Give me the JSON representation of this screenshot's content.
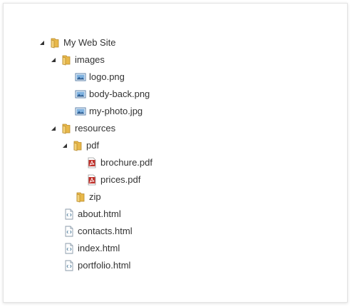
{
  "tree": {
    "nodes": [
      {
        "label": "My Web Site",
        "icon": "folder-icon",
        "expanded": true,
        "level": 0
      },
      {
        "label": "images",
        "icon": "folder-icon",
        "expanded": true,
        "level": 1
      },
      {
        "label": "logo.png",
        "icon": "image-file-icon",
        "level": 2
      },
      {
        "label": "body-back.png",
        "icon": "image-file-icon",
        "level": 2
      },
      {
        "label": "my-photo.jpg",
        "icon": "image-file-icon",
        "level": 2
      },
      {
        "label": "resources",
        "icon": "folder-icon",
        "expanded": true,
        "level": 1
      },
      {
        "label": "pdf",
        "icon": "folder-icon",
        "expanded": true,
        "level": 2
      },
      {
        "label": "brochure.pdf",
        "icon": "pdf-file-icon",
        "level": 3
      },
      {
        "label": "prices.pdf",
        "icon": "pdf-file-icon",
        "level": 3
      },
      {
        "label": "zip",
        "icon": "folder-icon",
        "level": 2
      },
      {
        "label": "about.html",
        "icon": "html-file-icon",
        "level": 1
      },
      {
        "label": "contacts.html",
        "icon": "html-file-icon",
        "level": 1
      },
      {
        "label": "index.html",
        "icon": "html-file-icon",
        "level": 1
      },
      {
        "label": "portfolio.html",
        "icon": "html-file-icon",
        "level": 1
      }
    ]
  },
  "colors": {
    "text": "#333333",
    "folder": "#e8b84a",
    "image_blue": "#3d7ab8",
    "pdf_red": "#c0302a"
  }
}
